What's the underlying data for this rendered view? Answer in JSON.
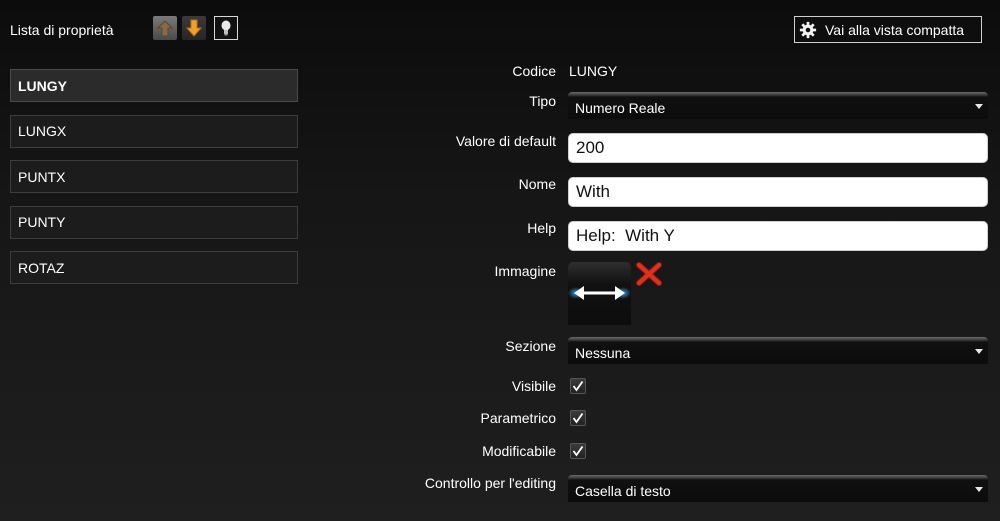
{
  "header": {
    "title": "Lista di proprietà",
    "compact_view_label": "Vai alla vista compatta",
    "tools": [
      "move-up-icon",
      "move-down-icon",
      "lightbulb-icon"
    ]
  },
  "property_list": {
    "items": [
      {
        "label": "LUNGY",
        "selected": true
      },
      {
        "label": "LUNGX",
        "selected": false
      },
      {
        "label": "PUNTX",
        "selected": false
      },
      {
        "label": "PUNTY",
        "selected": false
      },
      {
        "label": "ROTAZ",
        "selected": false
      }
    ]
  },
  "form": {
    "codice": {
      "label": "Codice",
      "value": "LUNGY"
    },
    "tipo": {
      "label": "Tipo",
      "value": "Numero Reale"
    },
    "valore_default": {
      "label": "Valore di default",
      "value": "200"
    },
    "nome": {
      "label": "Nome",
      "value": "With"
    },
    "help": {
      "label": "Help",
      "value": "Help:  With Y"
    },
    "immagine": {
      "label": "Immagine",
      "icon": "double-arrow-horizontal-icon",
      "delete_icon": "red-x-delete-icon"
    },
    "sezione": {
      "label": "Sezione",
      "value": "Nessuna"
    },
    "visibile": {
      "label": "Visibile",
      "checked": true
    },
    "parametrico": {
      "label": "Parametrico",
      "checked": true
    },
    "modificabile": {
      "label": "Modificabile",
      "checked": true
    },
    "controllo": {
      "label": "Controllo per l'editing",
      "value": "Casella di testo"
    }
  },
  "colors": {
    "background": "#1b1b1b",
    "accent_orange": "#f0a030",
    "delete_red": "#e03020",
    "image_glow_blue": "#3aa8ff"
  }
}
